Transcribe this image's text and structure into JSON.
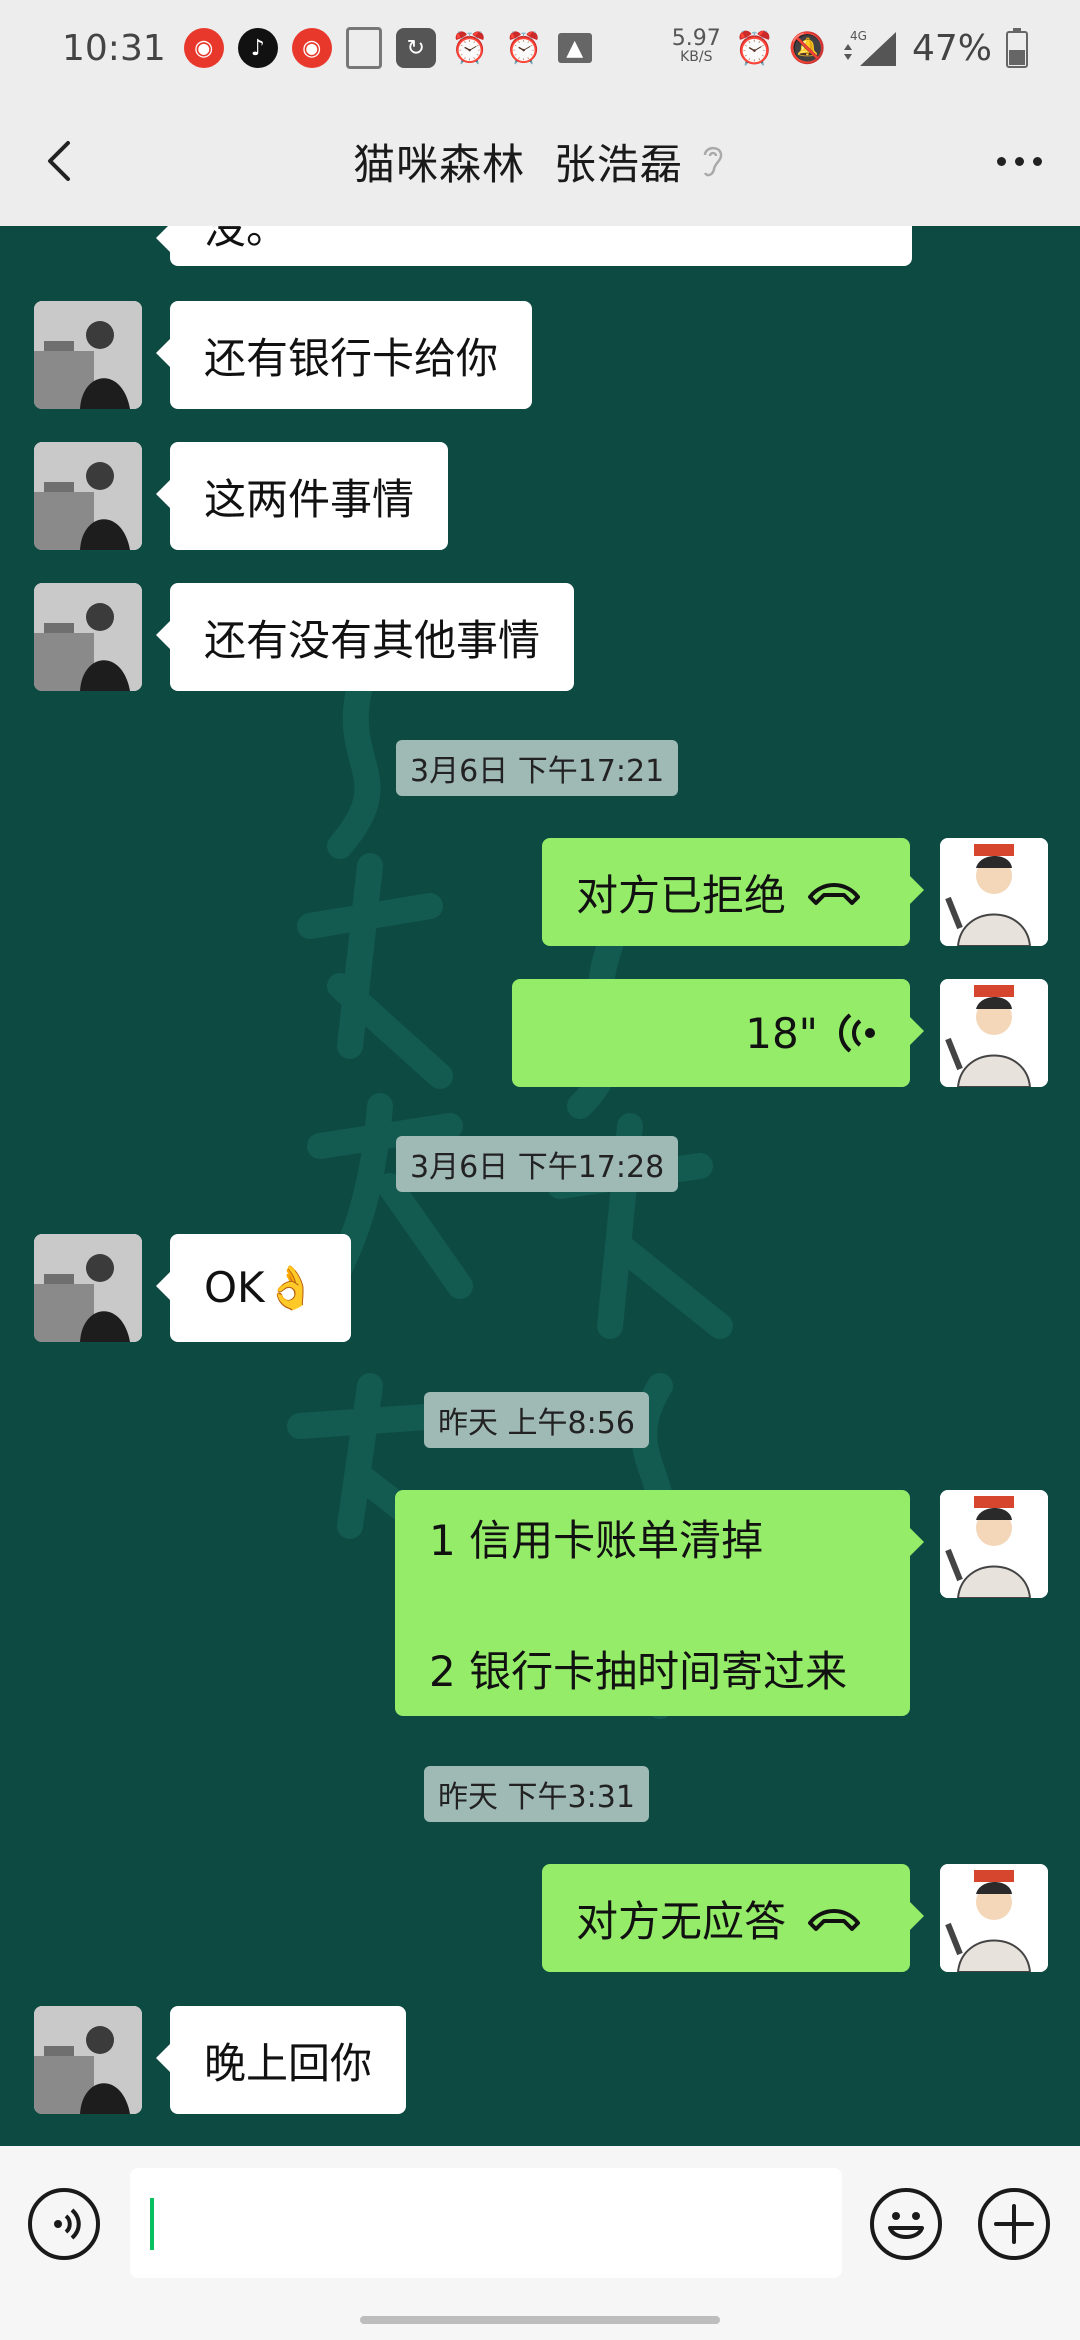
{
  "status_bar": {
    "time": "10:31",
    "net_speed_value": "5.97",
    "net_speed_unit": "KB/S",
    "network": "4G",
    "battery": "47%",
    "app_icons": [
      "weibo-icon",
      "tiktok-icon",
      "weibo-icon",
      "document-icon",
      "app-icon",
      "alarm-icon",
      "alarm-icon",
      "image-icon"
    ]
  },
  "header": {
    "title": "猫咪森林  张浩磊"
  },
  "messages": {
    "m0": "没。",
    "m1": "还有银行卡给你",
    "m2": "这两件事情",
    "m3": "还有没有其他事情",
    "t1": "3月6日 下午17:21",
    "m4": "对方已拒绝",
    "m5": "18\"",
    "t2": "3月6日 下午17:28",
    "m6": "OK👌",
    "t3": "昨天 上午8:56",
    "m7_line1": "1 信用卡账单清掉",
    "m7_line2": "2 银行卡抽时间寄过来",
    "t4": "昨天 下午3:31",
    "m8": "对方无应答",
    "m9": "晚上回你"
  },
  "input": {
    "value": ""
  },
  "colors": {
    "chat_background": "#0d4a42",
    "outgoing_bubble": "#95ec69",
    "incoming_bubble": "#ffffff",
    "bar_background": "#ededed",
    "caret": "#07c160"
  }
}
